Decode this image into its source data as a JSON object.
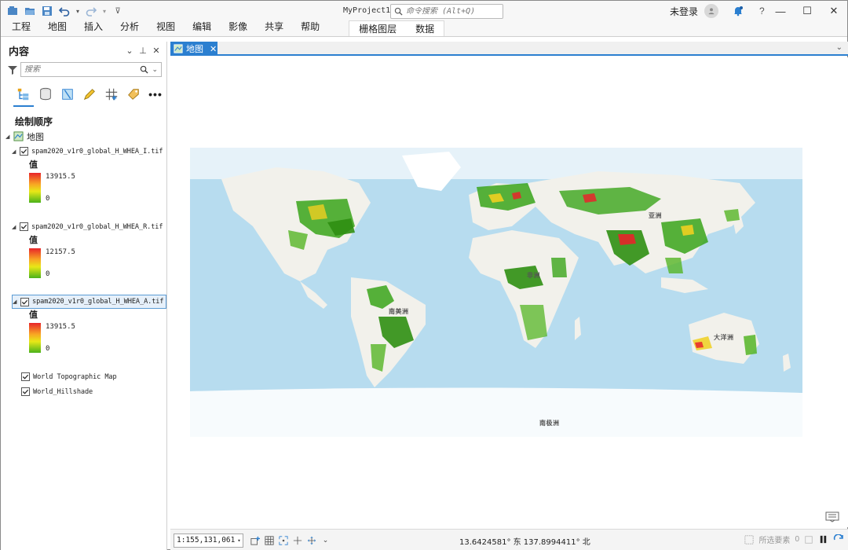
{
  "window": {
    "project_name": "MyProject1",
    "command_search_placeholder": "命令搜索 (Alt+Q)",
    "user_label": "未登录",
    "help": "?"
  },
  "ribbon": {
    "tabs": [
      "工程",
      "地图",
      "插入",
      "分析",
      "视图",
      "编辑",
      "影像",
      "共享",
      "帮助"
    ],
    "context_tabs": [
      "栅格图层",
      "数据"
    ]
  },
  "contents": {
    "title": "内容",
    "search_placeholder": "搜索",
    "more_label": "•••",
    "section_title": "绘制顺序",
    "map_node": "地图",
    "layers": [
      {
        "name": "spam2020_v1r0_global_H_WHEA_I.tif",
        "checked": true,
        "legend_title": "值",
        "max": "13915.5",
        "min": "0",
        "selected": false
      },
      {
        "name": "spam2020_v1r0_global_H_WHEA_R.tif",
        "checked": true,
        "legend_title": "值",
        "max": "12157.5",
        "min": "0",
        "selected": false
      },
      {
        "name": "spam2020_v1r0_global_H_WHEA_A.tif",
        "checked": true,
        "legend_title": "值",
        "max": "13915.5",
        "min": "0",
        "selected": true
      }
    ],
    "basemaps": [
      {
        "name": "World Topographic Map",
        "checked": true
      },
      {
        "name": "World_Hillshade",
        "checked": true
      }
    ]
  },
  "map": {
    "tab_label": "地图",
    "labels": {
      "asia": "亚洲",
      "africa": "非洲",
      "south_america": "南美洲",
      "oceania": "大洋洲",
      "antarctica": "南极洲"
    }
  },
  "status": {
    "scale": "1:155,131,061",
    "coordinates": "13.6424581° 东 137.8994411° 北",
    "selected_features_label": "所选要素",
    "selected_features_count": "0"
  },
  "colors": {
    "accent": "#2b7fd0",
    "ocean": "#b7dcef",
    "land": "#f2f1eb",
    "ice": "#ffffff",
    "crop_green": "#3aa51a",
    "crop_high": "#e8242a"
  }
}
